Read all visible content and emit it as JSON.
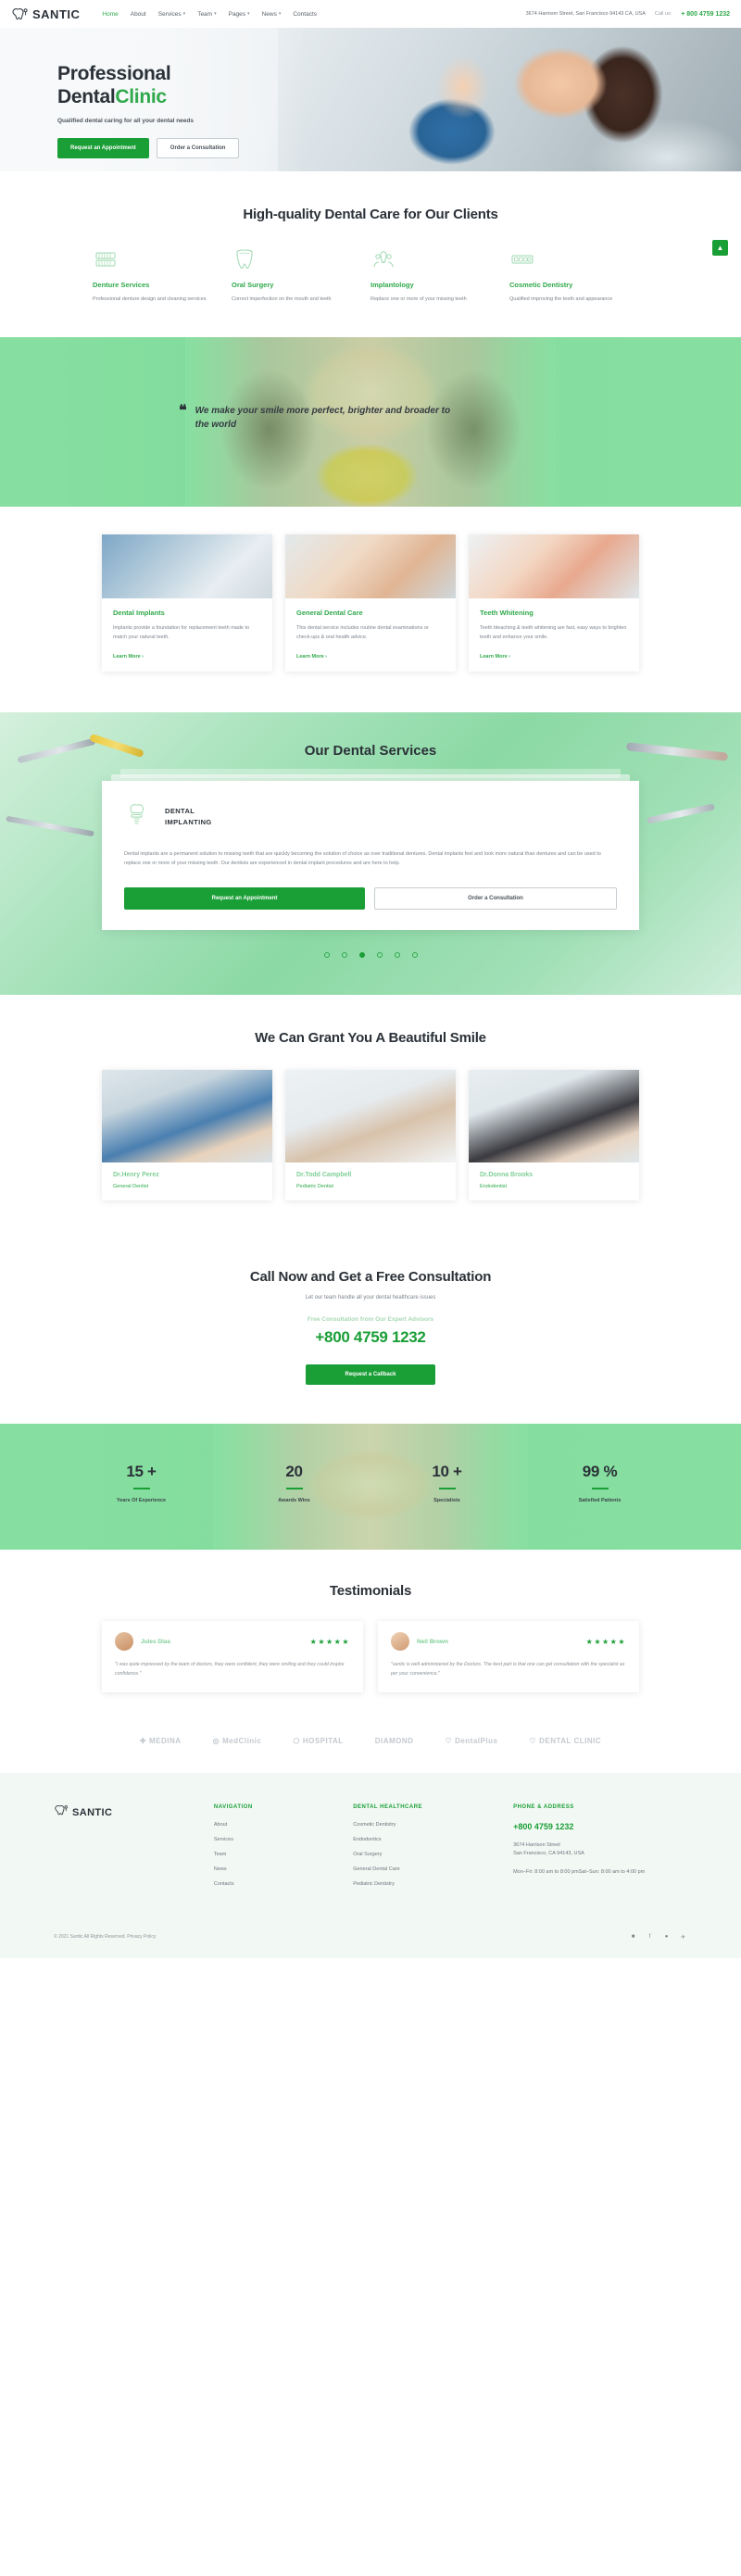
{
  "header": {
    "logo_text": "SANTIC",
    "nav": [
      {
        "label": "Home",
        "caret": false,
        "active": true
      },
      {
        "label": "About",
        "caret": false,
        "active": false
      },
      {
        "label": "Services",
        "caret": true,
        "active": false
      },
      {
        "label": "Team",
        "caret": true,
        "active": false
      },
      {
        "label": "Pages",
        "caret": true,
        "active": false
      },
      {
        "label": "News",
        "caret": true,
        "active": false
      },
      {
        "label": "Contacts",
        "caret": false,
        "active": false
      }
    ],
    "address": "3674 Harrison Street, San Francisco 94143 CA, USA",
    "call_label": "Call us:",
    "phone": "+ 800 4759 1232"
  },
  "hero": {
    "line1": "Professional",
    "line2_dark": "Dental",
    "line2_green": "Clinic",
    "subtitle": "Qualified dental caring for all your dental needs",
    "btn_primary": "Request an Appointment",
    "btn_secondary": "Order a Consultation"
  },
  "services": {
    "title": "High-quality Dental Care for Our Clients",
    "scroll_top": "▲",
    "items": [
      {
        "icon": "denture-icon",
        "name": "Denture Services",
        "desc": "Professional denture design and cleaning services"
      },
      {
        "icon": "jaw-icon",
        "name": "Oral Surgery",
        "desc": "Correct imperfection on the mouth and teeth"
      },
      {
        "icon": "implant-icon",
        "name": "Implantology",
        "desc": "Replace one or more of your missing teeth"
      },
      {
        "icon": "braces-icon",
        "name": "Cosmetic Dentistry",
        "desc": "Qualified improving the teeth and appearance"
      }
    ]
  },
  "quote": {
    "mark": "❝",
    "text": "We make your smile more perfect, brighter and broader to the world"
  },
  "cards": [
    {
      "title": "Dental Implants",
      "desc": "Implants provide a foundation for replacement teeth made to match your natural teeth.",
      "link": "Learn More  ›"
    },
    {
      "title": "General Dental Care",
      "desc": "This dental service includes routine dental examinations or check-ups & oral health advice.",
      "link": "Learn More  ›"
    },
    {
      "title": "Teeth Whitening",
      "desc": "Teeth bleaching & teeth whitening are fast, easy ways to brighten teeth and enhance your smile.",
      "link": "Learn More  ›"
    }
  ],
  "slider": {
    "title": "Our Dental Services",
    "panel_icon": "tooth-implant-icon",
    "panel_title_line1": "DENTAL",
    "panel_title_line2": "IMPLANTING",
    "panel_text": "Dental implants are a permanent solution to missing teeth that are quickly becoming the solution of choice as over traditional dentures. Dental implants feel and look more natural than dentures and can be used to replace one or more of your missing teeth. Our dentists are experienced in dental implant procedures and are here to help.",
    "btn_primary": "Request an Appointment",
    "btn_secondary": "Order a Consultation",
    "dots": [
      false,
      false,
      true,
      false,
      false,
      false
    ]
  },
  "team": {
    "title": "We Can Grant You A Beautiful Smile",
    "members": [
      {
        "name": "Dr.Henry Perez",
        "role": "General Dentist"
      },
      {
        "name": "Dr.Todd Campbell",
        "role": "Pediatric Dentist"
      },
      {
        "name": "Dr.Donna Brooks",
        "role": "Endodontist"
      }
    ]
  },
  "cta": {
    "title": "Call Now and Get a Free Consultation",
    "subtitle": "Let our team handle all your dental healthcare issues",
    "small": "Free Consultation from Our Expert Advisors",
    "phone": "+800 4759 1232",
    "button": "Request a Callback"
  },
  "stats": [
    {
      "number": "15 +",
      "label": "Years Of Experience"
    },
    {
      "number": "20",
      "label": "Awards Wins"
    },
    {
      "number": "10 +",
      "label": "Specialists"
    },
    {
      "number": "99 %",
      "label": "Satisfied Patients"
    }
  ],
  "testimonials": {
    "title": "Testimonials",
    "items": [
      {
        "name": "Jules Dias",
        "stars": "★★★★★",
        "quote": "\"I was quite impressed by the team of doctors, they were confident, they were smiling and they could inspire confidence.\""
      },
      {
        "name": "Neil Brown",
        "stars": "★★★★★",
        "quote": "\"santic is well administered by the Doctors. The best part is that one can get consultation with the specialist as per your convenience.\""
      }
    ]
  },
  "brands": [
    {
      "label": "MEDINA",
      "icon": "cross-icon"
    },
    {
      "label": "MedClinic",
      "icon": "circle-icon"
    },
    {
      "label": "HOSPITAL",
      "icon": "h-icon"
    },
    {
      "label": "DIAMOND",
      "icon": "diamond-icon"
    },
    {
      "label": "DentalPlus",
      "icon": "tooth-icon"
    },
    {
      "label": "DENTAL CLINIC",
      "icon": "tooth-icon"
    }
  ],
  "footer": {
    "logo_text": "SANTIC",
    "col_nav_head": "NAVIGATION",
    "col_nav": [
      "About",
      "Services",
      "Team",
      "News",
      "Contacts"
    ],
    "col_health_head": "DENTAL HEALTHCARE",
    "col_health": [
      "Cosmetic Dentistry",
      "Endodontics",
      "Oral Surgery",
      "General Dental Care",
      "Pediatric Dentistry"
    ],
    "col_contact_head": "PHONE & ADDRESS",
    "phone": "+800 4759 1232",
    "address": "3674 Harrison Street\nSan Francisco, CA 94143, USA",
    "hours": "Mon–Fri: 8:00 am to 8:00 pmSat–Sun: 8:00 am to 4:00 pm",
    "copyright": "© 2021 Santic All Rights Reserved. Privacy Policy",
    "social": [
      "■",
      "f",
      "●",
      "✈"
    ]
  }
}
